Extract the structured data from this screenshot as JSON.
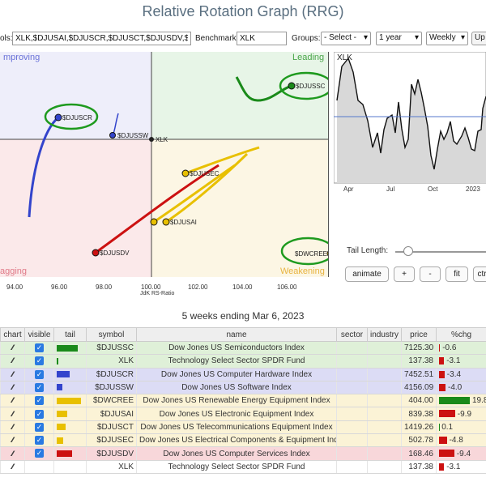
{
  "app": {
    "title": "Relative Rotation Graph (RRG)"
  },
  "toolbar": {
    "symbols_label": "ols:",
    "symbols_value": "XLK,$DJUSAI,$DJUSCR,$DJUSCT,$DJUSDV,$DJ",
    "benchmark_label": "Benchmark:",
    "benchmark_value": "XLK",
    "groups_label": "Groups:",
    "groups_value": "- Select -",
    "period_value": "1 year",
    "frequency_value": "Weekly",
    "more_label": "Up"
  },
  "rrg": {
    "quadrants": {
      "improving": "mproving",
      "leading": "Leading",
      "lagging": "agging",
      "weakening": "Weakening"
    },
    "x_axis_label": "JdK RS-Ratio",
    "x_ticks": [
      "94.00",
      "96.00",
      "98.00",
      "100.00",
      "102.00",
      "104.00",
      "106.00"
    ],
    "colors": {
      "improving": "#eeeefa",
      "leading": "#e7f5e7",
      "lagging": "#fbe9ea",
      "weakening": "#fcf6e4"
    },
    "points": [
      {
        "symbol": "$DJUSSC",
        "color": "#1a8a1a"
      },
      {
        "symbol": "$DJUSCR",
        "color": "#3344cc"
      },
      {
        "symbol": "$DJUSSW",
        "color": "#3344cc"
      },
      {
        "symbol": "XLK",
        "color": "#222222"
      },
      {
        "symbol": "$DJUSEC",
        "color": "#e8c000"
      },
      {
        "symbol": "$DJUSAI",
        "color": "#e8c000"
      },
      {
        "symbol": "$DJUSCT",
        "color": "#e8c000"
      },
      {
        "symbol": "$DJUSDV",
        "color": "#cc1111"
      },
      {
        "symbol": "$DWCREE",
        "color": "#e8c000"
      }
    ]
  },
  "side_chart": {
    "label": "XLK",
    "x_ticks": [
      "Apr",
      "Jul",
      "Oct",
      "2023"
    ]
  },
  "tail_control": {
    "label": "Tail Length:"
  },
  "buttons": {
    "animate": "animate",
    "plus": "+",
    "minus": "-",
    "fit": "fit",
    "ctrl": "ctr"
  },
  "caption": "5 weeks ending Mar 6, 2023",
  "table": {
    "headers": [
      "chart",
      "visible",
      "tail",
      "symbol",
      "name",
      "sector",
      "industry",
      "price",
      "%chg"
    ],
    "rows": [
      {
        "bg": "#dff0d8",
        "tail_color": "#1a8a1a",
        "tail_w": 26,
        "symbol": "$DJUSSC",
        "name": "Dow Jones US Semiconductors Index",
        "price": "7125.30",
        "chg": "-0.6",
        "chg_color": "#cc1111",
        "chg_pct": -0.6
      },
      {
        "bg": "#dff0d8",
        "tail_color": "#1a8a1a",
        "tail_w": 2,
        "symbol": "XLK",
        "name": "Technology Select Sector SPDR Fund",
        "price": "137.38",
        "chg": "-3.1",
        "chg_color": "#cc1111",
        "chg_pct": -3.1
      },
      {
        "bg": "#dcdcf5",
        "tail_color": "#3344cc",
        "tail_w": 16,
        "symbol": "$DJUSCR",
        "name": "Dow Jones US Computer Hardware Index",
        "price": "7452.51",
        "chg": "-3.4",
        "chg_color": "#cc1111",
        "chg_pct": -3.4
      },
      {
        "bg": "#dcdcf5",
        "tail_color": "#3344cc",
        "tail_w": 7,
        "symbol": "$DJUSSW",
        "name": "Dow Jones US Software Index",
        "price": "4156.09",
        "chg": "-4.0",
        "chg_color": "#cc1111",
        "chg_pct": -4.0
      },
      {
        "bg": "#fbf3d6",
        "tail_color": "#e8c000",
        "tail_w": 30,
        "symbol": "$DWCREE",
        "name": "Dow Jones US Renewable Energy Equipment Index",
        "price": "404.00",
        "chg": "19.8",
        "chg_color": "#1a8a1a",
        "chg_pct": 19.8
      },
      {
        "bg": "#fbf3d6",
        "tail_color": "#e8c000",
        "tail_w": 13,
        "symbol": "$DJUSAI",
        "name": "Dow Jones US Electronic Equipment Index",
        "price": "839.38",
        "chg": "-9.9",
        "chg_color": "#cc1111",
        "chg_pct": -9.9
      },
      {
        "bg": "#fbf3d6",
        "tail_color": "#e8c000",
        "tail_w": 11,
        "symbol": "$DJUSCT",
        "name": "Dow Jones US Telecommunications Equipment Index",
        "price": "1419.26",
        "chg": "0.1",
        "chg_color": "#1a8a1a",
        "chg_pct": 0.1
      },
      {
        "bg": "#fbf3d6",
        "tail_color": "#e8c000",
        "tail_w": 8,
        "symbol": "$DJUSEC",
        "name": "Dow Jones US Electrical Components & Equipment Index",
        "price": "502.78",
        "chg": "-4.8",
        "chg_color": "#cc1111",
        "chg_pct": -4.8
      },
      {
        "bg": "#f8d7da",
        "tail_color": "#cc1111",
        "tail_w": 19,
        "symbol": "$DJUSDV",
        "name": "Dow Jones US Computer Services Index",
        "price": "168.46",
        "chg": "-9.4",
        "chg_color": "#cc1111",
        "chg_pct": -9.4
      },
      {
        "bg": "#ffffff",
        "tail_color": "#ffffff",
        "tail_w": 0,
        "symbol": "XLK",
        "name": "Technology Select Sector SPDR Fund",
        "price": "137.38",
        "chg": "-3.1",
        "chg_color": "#cc1111",
        "chg_pct": -3.1
      }
    ]
  }
}
